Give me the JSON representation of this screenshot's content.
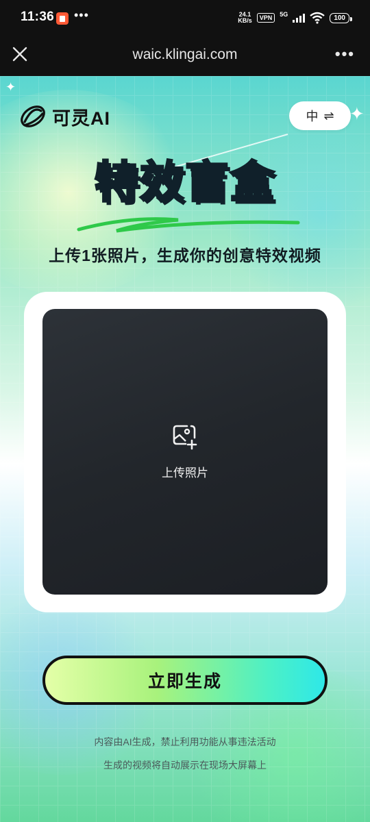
{
  "status_bar": {
    "time": "11:36",
    "dots": "•••",
    "speed_value": "24.1",
    "speed_unit": "KB/s",
    "vpn": "VPN",
    "network": "5G",
    "battery": "100"
  },
  "browser": {
    "url": "waic.klingai.com",
    "more": "•••"
  },
  "header": {
    "logo_text": "可灵AI",
    "lang_label": "中",
    "lang_switch_glyph": "⇌"
  },
  "hero": {
    "title_part1": "特效",
    "title_part2": "盲盒",
    "subtitle": "上传1张照片，生成你的创意特效视频"
  },
  "upload": {
    "label": "上传照片"
  },
  "actions": {
    "generate_label": "立即生成"
  },
  "notices": {
    "line1": "内容由AI生成，禁止利用功能从事违法活动",
    "line2": "生成的视频将自动展示在现场大屏幕上"
  },
  "colors": {
    "accent_green": "#c9f25b",
    "dark": "#10202a",
    "upload_bg": "#22262b"
  }
}
